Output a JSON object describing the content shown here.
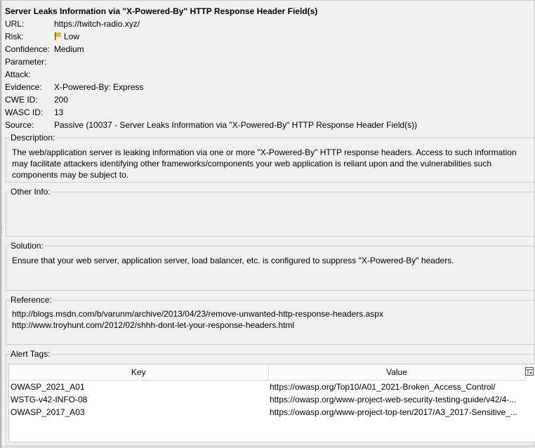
{
  "alert": {
    "title": "Server Leaks Information via \"X-Powered-By\" HTTP Response Header Field(s)",
    "fields": [
      {
        "key": "url",
        "label": "URL:",
        "value": "https://twitch-radio.xyz/"
      },
      {
        "key": "risk",
        "label": "Risk:",
        "value": "Low"
      },
      {
        "key": "confidence",
        "label": "Confidence:",
        "value": "Medium"
      },
      {
        "key": "parameter",
        "label": "Parameter:",
        "value": ""
      },
      {
        "key": "attack",
        "label": "Attack:",
        "value": ""
      },
      {
        "key": "evidence",
        "label": "Evidence:",
        "value": "X-Powered-By: Express"
      },
      {
        "key": "cwe",
        "label": "CWE ID:",
        "value": "200"
      },
      {
        "key": "wasc",
        "label": "WASC ID:",
        "value": "13"
      },
      {
        "key": "source",
        "label": "Source:",
        "value": "Passive (10037 - Server Leaks Information via \"X-Powered-By\" HTTP Response Header Field(s))"
      }
    ],
    "risk_flag_color": "#f2c200",
    "description": {
      "label": "Description:",
      "text": "The web/application server is leaking information via one or more \"X-Powered-By\" HTTP response headers. Access to such information may facilitate attackers identifying other frameworks/components your web application is reliant upon and the vulnerabilities such components may be subject to."
    },
    "other_info": {
      "label": "Other Info:",
      "text": ""
    },
    "solution": {
      "label": "Solution:",
      "text": "Ensure that your web server, application server, load balancer, etc. is configured to suppress \"X-Powered-By\" headers."
    },
    "reference": {
      "label": "Reference:",
      "lines": [
        "http://blogs.msdn.com/b/varunm/archive/2013/04/23/remove-unwanted-http-response-headers.aspx",
        "http://www.troyhunt.com/2012/02/shhh-dont-let-your-response-headers.html"
      ]
    },
    "alert_tags": {
      "label": "Alert Tags:",
      "columns": [
        "Key",
        "Value"
      ],
      "column_selector_icon": "column-selector-icon",
      "rows": [
        {
          "key": "OWASP_2021_A01",
          "value": "https://owasp.org/Top10/A01_2021-Broken_Access_Control/"
        },
        {
          "key": "WSTG-v42-INFO-08",
          "value": "https://owasp.org/www-project-web-security-testing-guide/v42/4-..."
        },
        {
          "key": "OWASP_2017_A03",
          "value": "https://owasp.org/www-project-top-ten/2017/A3_2017-Sensitive_..."
        }
      ]
    }
  }
}
